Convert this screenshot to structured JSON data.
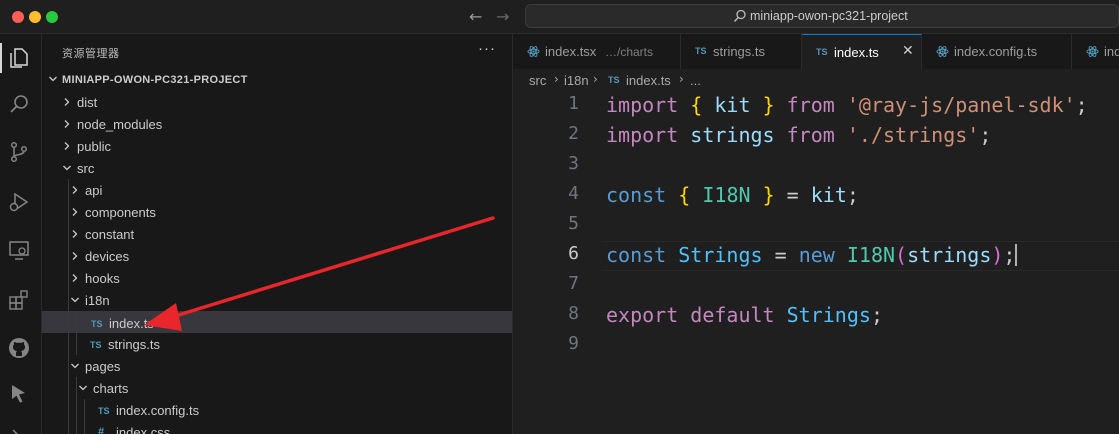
{
  "window": {
    "search_text": "miniapp-owon-pc321-project"
  },
  "activity_bar": {
    "icons": [
      "explorer-icon",
      "search-icon",
      "source-control-icon",
      "run-debug-icon",
      "remote-explorer-icon",
      "extensions-icon",
      "github-icon",
      "cursor-pointer-icon"
    ]
  },
  "sidebar": {
    "title": "资源管理器",
    "more": "···",
    "project_name": "MINIAPP-OWON-PC321-PROJECT",
    "tree": [
      {
        "label": "dist",
        "type": "folder",
        "expanded": false,
        "depth": 0
      },
      {
        "label": "node_modules",
        "type": "folder",
        "expanded": false,
        "depth": 0
      },
      {
        "label": "public",
        "type": "folder",
        "expanded": false,
        "depth": 0
      },
      {
        "label": "src",
        "type": "folder",
        "expanded": true,
        "depth": 0
      },
      {
        "label": "api",
        "type": "folder",
        "expanded": false,
        "depth": 1
      },
      {
        "label": "components",
        "type": "folder",
        "expanded": false,
        "depth": 1
      },
      {
        "label": "constant",
        "type": "folder",
        "expanded": false,
        "depth": 1
      },
      {
        "label": "devices",
        "type": "folder",
        "expanded": false,
        "depth": 1
      },
      {
        "label": "hooks",
        "type": "folder",
        "expanded": false,
        "depth": 1
      },
      {
        "label": "i18n",
        "type": "folder",
        "expanded": true,
        "depth": 1
      },
      {
        "label": "index.ts",
        "type": "ts",
        "depth": 2,
        "selected": true
      },
      {
        "label": "strings.ts",
        "type": "ts",
        "depth": 2
      },
      {
        "label": "pages",
        "type": "folder",
        "expanded": true,
        "depth": 1
      },
      {
        "label": "charts",
        "type": "folder",
        "expanded": true,
        "depth": 2
      },
      {
        "label": "index.config.ts",
        "type": "ts",
        "depth": 3
      },
      {
        "label": "index.css",
        "type": "css",
        "depth": 3
      }
    ],
    "ts_badge": "TS",
    "css_badge": "#"
  },
  "tabs": [
    {
      "label": "index.tsx",
      "desc": "…/charts",
      "icon": "react-icon",
      "active": false
    },
    {
      "label": "strings.ts",
      "icon_text": "TS",
      "active": false
    },
    {
      "label": "index.ts",
      "icon_text": "TS",
      "active": true,
      "close": "✕"
    },
    {
      "label": "index.config.ts",
      "icon": "react-icon",
      "active": false
    },
    {
      "label": "inde",
      "icon": "react-icon",
      "active": false
    }
  ],
  "breadcrumb": {
    "parts": [
      "src",
      "i18n",
      "index.ts",
      "..."
    ],
    "sep": "›",
    "ts_badge": "TS"
  },
  "editor": {
    "current_line": 6,
    "lines": [
      {
        "n": "1",
        "tokens": [
          [
            "kw",
            "import"
          ],
          [
            "punc",
            " "
          ],
          [
            "br",
            "{"
          ],
          [
            "punc",
            " "
          ],
          [
            "var",
            "kit"
          ],
          [
            "punc",
            " "
          ],
          [
            "br",
            "}"
          ],
          [
            "punc",
            " "
          ],
          [
            "kw",
            "from"
          ],
          [
            "punc",
            " "
          ],
          [
            "str",
            "'@ray-js/panel-sdk'"
          ],
          [
            "punc",
            ";"
          ]
        ]
      },
      {
        "n": "2",
        "tokens": [
          [
            "kw",
            "import"
          ],
          [
            "punc",
            " "
          ],
          [
            "var",
            "strings"
          ],
          [
            "punc",
            " "
          ],
          [
            "kw",
            "from"
          ],
          [
            "punc",
            " "
          ],
          [
            "str",
            "'./strings'"
          ],
          [
            "punc",
            ";"
          ]
        ]
      },
      {
        "n": "3",
        "tokens": []
      },
      {
        "n": "4",
        "tokens": [
          [
            "decl",
            "const"
          ],
          [
            "punc",
            " "
          ],
          [
            "br",
            "{"
          ],
          [
            "punc",
            " "
          ],
          [
            "cls",
            "I18N"
          ],
          [
            "punc",
            " "
          ],
          [
            "br",
            "}"
          ],
          [
            "punc",
            " = "
          ],
          [
            "var",
            "kit"
          ],
          [
            "punc",
            ";"
          ]
        ]
      },
      {
        "n": "5",
        "tokens": []
      },
      {
        "n": "6",
        "tokens": [
          [
            "decl",
            "const"
          ],
          [
            "punc",
            " "
          ],
          [
            "cst",
            "Strings"
          ],
          [
            "punc",
            " = "
          ],
          [
            "decl",
            "new"
          ],
          [
            "punc",
            " "
          ],
          [
            "cls",
            "I18N"
          ],
          [
            "par",
            "("
          ],
          [
            "var",
            "strings"
          ],
          [
            "par",
            ")"
          ],
          [
            "punc",
            ";"
          ]
        ]
      },
      {
        "n": "7",
        "tokens": []
      },
      {
        "n": "8",
        "tokens": [
          [
            "kw",
            "export"
          ],
          [
            "punc",
            " "
          ],
          [
            "kw",
            "default"
          ],
          [
            "punc",
            " "
          ],
          [
            "cst",
            "Strings"
          ],
          [
            "punc",
            ";"
          ]
        ]
      },
      {
        "n": "9",
        "tokens": []
      }
    ]
  },
  "colors": {
    "annotation_arrow": "#e8262b",
    "accent": "#0078d4"
  }
}
